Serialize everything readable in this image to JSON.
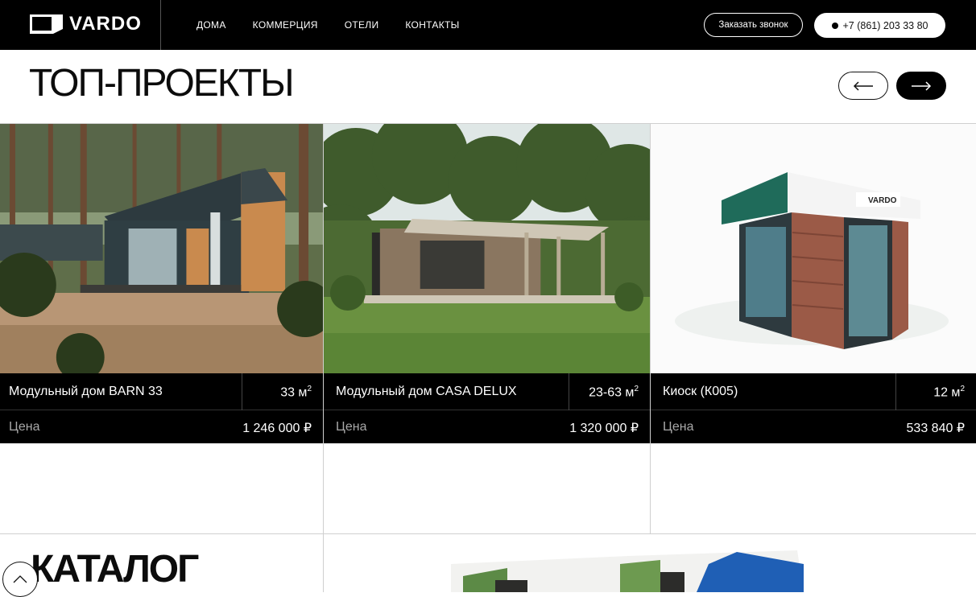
{
  "header": {
    "logo_text": "VARDO",
    "nav": [
      "ДОМА",
      "КОММЕРЦИЯ",
      "ОТЕЛИ",
      "КОНТАКТЫ"
    ],
    "call_button": "Заказать звонок",
    "phone": "+7 (861) 203 33 80"
  },
  "top_projects": {
    "title": "ТОП-ПРОЕКТЫ",
    "cards": [
      {
        "name": "Модульный дом BARN 33",
        "area": "33 м",
        "area_sup": "2",
        "price_label": "Цена",
        "price": "1 246 000 ₽"
      },
      {
        "name": "Модульный дом CASA DELUX",
        "area": "23-63 м",
        "area_sup": "2",
        "price_label": "Цена",
        "price": "1 320 000 ₽"
      },
      {
        "name": "Киоск (К005)",
        "area": "12 м",
        "area_sup": "2",
        "price_label": "Цена",
        "price": "533 840 ₽"
      }
    ]
  },
  "catalog": {
    "title": "КАТАЛОГ"
  },
  "icons": {
    "arrow_prev": "arrow-left-icon",
    "arrow_next": "arrow-right-icon",
    "scroll_up": "chevron-up-icon",
    "phone_dot": "dot-icon"
  },
  "colors": {
    "header_bg": "#000000",
    "accent": "#000000",
    "text": "#111111"
  }
}
